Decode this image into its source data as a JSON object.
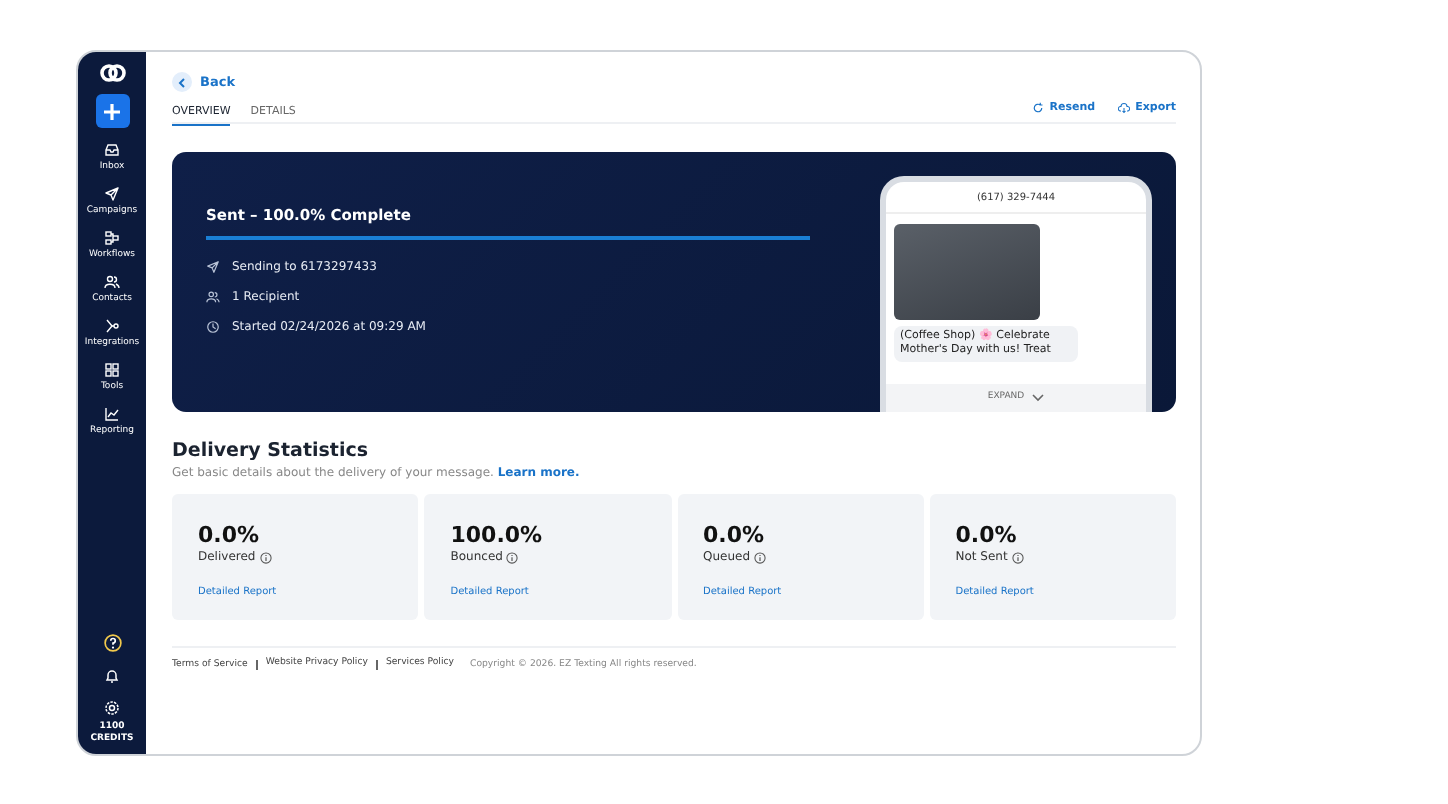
{
  "sidebar": {
    "items": [
      {
        "label": "Inbox"
      },
      {
        "label": "Campaigns"
      },
      {
        "label": "Workflows"
      },
      {
        "label": "Contacts"
      },
      {
        "label": "Integrations"
      },
      {
        "label": "Tools"
      },
      {
        "label": "Reporting"
      }
    ],
    "credits": [
      "1100",
      "CREDITS"
    ]
  },
  "back": "Back",
  "tabs": [
    {
      "label": "OVERVIEW",
      "selected": true
    },
    {
      "label": "DETAILS",
      "selected": false
    }
  ],
  "actions": [
    {
      "label": "Resend"
    },
    {
      "label": "Export"
    }
  ],
  "hero": {
    "title": "Sent – 100.0% Complete",
    "progress": {
      "level": 1
    },
    "details": [
      "Sending to 6173297433",
      "1 Recipient",
      "Started 02/24/2026 at 09:29 AM"
    ],
    "phone": {
      "number": "(617) 329-7444",
      "message": "(Coffee Shop) 🌸 Celebrate Mother's Day with us! Treat",
      "expand": "EXPAND"
    }
  },
  "stats": {
    "title": "Delivery Statistics",
    "subtitle": "Get basic details about the delivery of your message.",
    "link": "Learn more.",
    "cards": [
      {
        "value": "0.0%",
        "label": "Delivered",
        "link": "Detailed Report"
      },
      {
        "value": "100.0%",
        "label": "Bounced",
        "link": "Detailed Report"
      },
      {
        "value": "0.0%",
        "label": "Queued",
        "link": "Detailed Report"
      },
      {
        "value": "0.0%",
        "label": "Not Sent",
        "link": "Detailed Report"
      }
    ]
  },
  "footer": {
    "links": [
      "Terms of Service",
      "Website Privacy Policy",
      "Services Policy"
    ],
    "copyright": "Copyright © 2026. EZ Texting All rights reserved."
  }
}
